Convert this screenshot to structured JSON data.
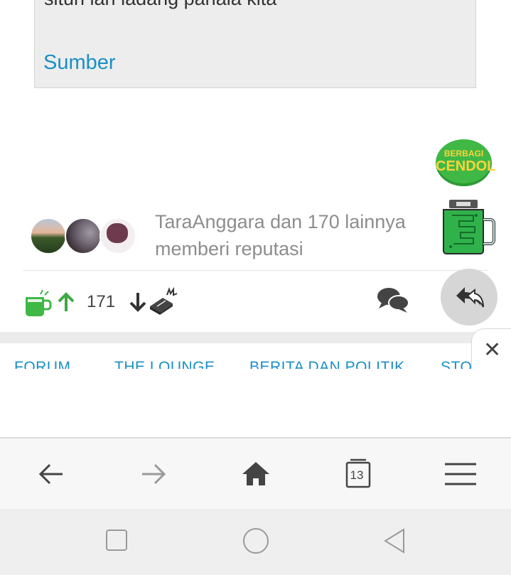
{
  "post": {
    "quote_text": "situn lan ladang panala kita",
    "source_link": "Sumber"
  },
  "cendol": {
    "badge_line1": "BERBAGI",
    "badge_line2": "CENDOL"
  },
  "reputation": {
    "text": "TaraAnggara dan 170 lainnya memberi reputasi"
  },
  "actions": {
    "vote_count": "171"
  },
  "forum_nav": {
    "items": [
      "FORUM",
      "THE LOUNGE",
      "BERITA DAN POLITIK",
      "STORIES FROM THE HEART"
    ]
  },
  "browser": {
    "tab_count": "13"
  },
  "colors": {
    "link_blue": "#1a8fc5",
    "cendol_green": "#3fb845",
    "up_green": "#3fa845"
  }
}
